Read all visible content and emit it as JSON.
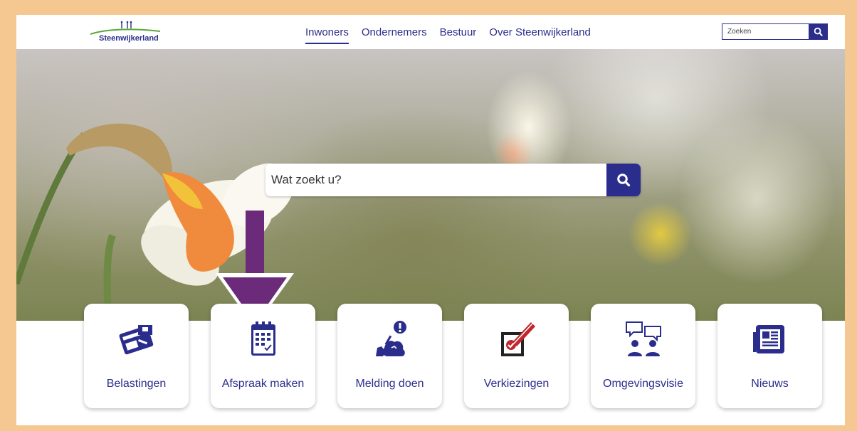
{
  "header": {
    "logo_text": "Steenwijkerland",
    "nav": [
      {
        "label": "Inwoners",
        "active": true
      },
      {
        "label": "Ondernemers",
        "active": false
      },
      {
        "label": "Bestuur",
        "active": false
      },
      {
        "label": "Over Steenwijkerland",
        "active": false
      }
    ],
    "search_placeholder": "Zoeken"
  },
  "hero": {
    "search_placeholder": "Wat zoekt u?"
  },
  "tiles": [
    {
      "label": "Belastingen",
      "icon": "tax-card-icon"
    },
    {
      "label": "Afspraak maken",
      "icon": "calendar-icon"
    },
    {
      "label": "Melding doen",
      "icon": "report-issue-icon"
    },
    {
      "label": "Verkiezingen",
      "icon": "ballot-icon"
    },
    {
      "label": "Omgevingsvisie",
      "icon": "people-conversation-icon"
    },
    {
      "label": "Nieuws",
      "icon": "newspaper-icon"
    }
  ],
  "colors": {
    "brand": "#2b2d8c",
    "accent_red": "#c1272d",
    "arrow": "#6b2a7a",
    "frame": "#f5c891"
  }
}
